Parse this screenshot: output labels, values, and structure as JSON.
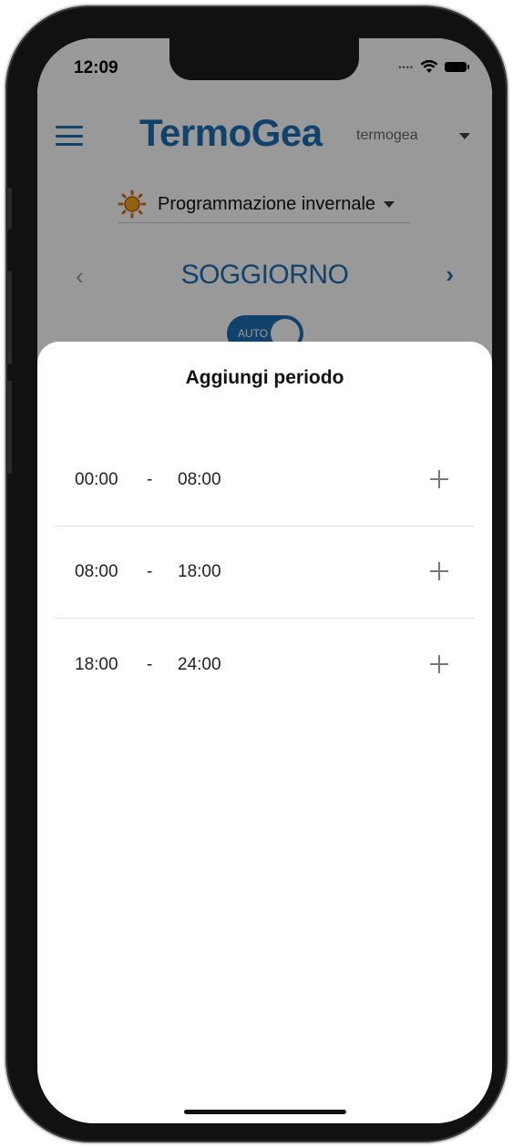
{
  "status_bar": {
    "time": "12:09",
    "signal_icon": "signal-dots-icon",
    "wifi_icon": "wifi-icon",
    "battery_icon": "battery-icon"
  },
  "header": {
    "logo_text": "TermoGea",
    "account_name": "termogea",
    "menu_icon": "hamburger-menu-icon",
    "account_dropdown_icon": "caret-down-icon"
  },
  "program": {
    "label": "Programmazione invernale",
    "icon": "sun-icon"
  },
  "zone": {
    "name": "SOGGIORNO",
    "prev_icon": "chevron-left-icon",
    "next_icon": "chevron-right-icon",
    "mode_label": "AUTO"
  },
  "sheet": {
    "title": "Aggiungi periodo",
    "periods": [
      {
        "start": "00:00",
        "separator": "-",
        "end": "08:00"
      },
      {
        "start": "08:00",
        "separator": "-",
        "end": "18:00"
      },
      {
        "start": "18:00",
        "separator": "-",
        "end": "24:00"
      }
    ]
  },
  "colors": {
    "accent": "#1b6fb3",
    "sun": "#f0a020",
    "overlay": "rgba(0,0,0,0.40)"
  }
}
